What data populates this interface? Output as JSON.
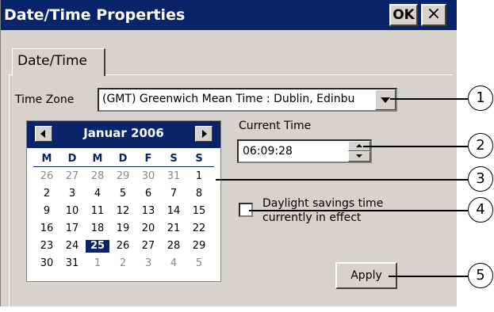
{
  "window": {
    "title": "Date/Time Properties",
    "ok_label": "OK",
    "close_label": "×"
  },
  "tabs": [
    {
      "label": "Date/Time"
    }
  ],
  "timezone": {
    "label": "Time Zone",
    "value": "(GMT) Greenwich Mean Time : Dublin, Edinbu"
  },
  "calendar": {
    "month_label": "Januar 2006",
    "weekdays": [
      "M",
      "D",
      "M",
      "D",
      "F",
      "S",
      "S"
    ],
    "weeks": [
      [
        "26",
        "27",
        "28",
        "29",
        "30",
        "31",
        "1"
      ],
      [
        "2",
        "3",
        "4",
        "5",
        "6",
        "7",
        "8"
      ],
      [
        "9",
        "10",
        "11",
        "12",
        "13",
        "14",
        "15"
      ],
      [
        "16",
        "17",
        "18",
        "19",
        "20",
        "21",
        "22"
      ],
      [
        "23",
        "24",
        "25",
        "26",
        "27",
        "28",
        "29"
      ],
      [
        "30",
        "31",
        "1",
        "2",
        "3",
        "4",
        "5"
      ]
    ],
    "selected_day": "25"
  },
  "time": {
    "label": "Current Time",
    "value": "06:09:28"
  },
  "daylight": {
    "label_line1": "Daylight savings time",
    "label_line2": "currently in effect",
    "checked": false
  },
  "apply_label": "Apply",
  "callouts": [
    "1",
    "2",
    "3",
    "4",
    "5"
  ],
  "colors": {
    "titlebar": "#0a246a",
    "face": "#d6d3ce",
    "selection": "#0a246a"
  }
}
